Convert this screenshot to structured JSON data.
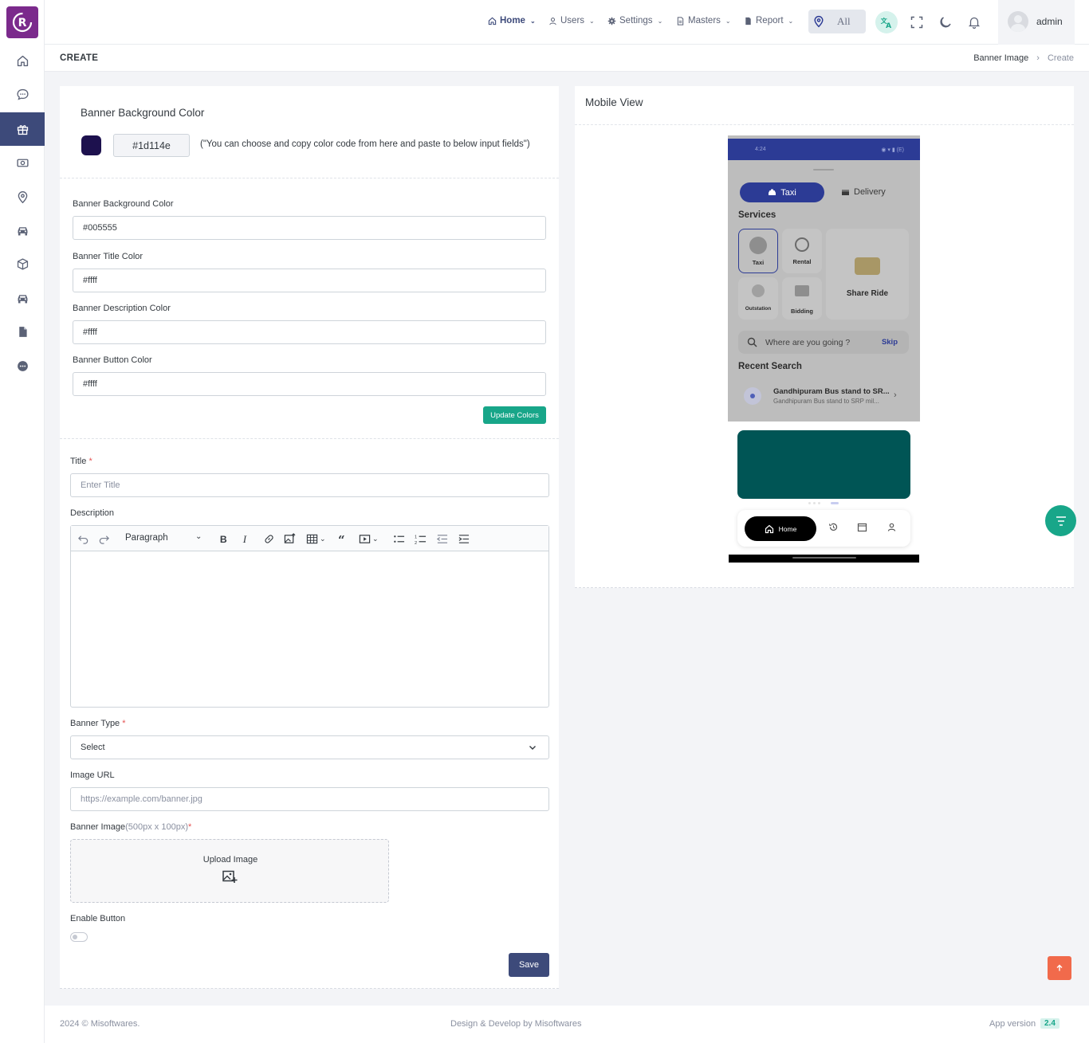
{
  "topbar": {
    "menu": [
      {
        "label": "Home",
        "icon": "home-icon"
      },
      {
        "label": "Users",
        "icon": "user-icon"
      },
      {
        "label": "Settings",
        "icon": "gear-icon"
      },
      {
        "label": "Masters",
        "icon": "document-icon"
      },
      {
        "label": "Report",
        "icon": "file-icon"
      }
    ],
    "zone_label": "All",
    "user_name": "admin"
  },
  "page": {
    "title": "CREATE",
    "breadcrumb": [
      "Banner Image",
      "Create"
    ]
  },
  "color_picker": {
    "heading": "Banner Background Color",
    "swatch_color": "#1d114e",
    "code": "#1d114e",
    "hint": "(\"You can choose and copy color code from here and paste to below input fields\")"
  },
  "color_form": {
    "bg_label": "Banner Background Color",
    "bg_value": "#005555",
    "title_label": "Banner Title Color",
    "title_value": "#ffff",
    "desc_label": "Banner Description Color",
    "desc_value": "#ffff",
    "button_label": "Banner Button Color",
    "button_value": "#ffff",
    "update_button": "Update Colors"
  },
  "form": {
    "title_label": "Title",
    "title_placeholder": "Enter Title",
    "description_label": "Description",
    "paragraph_select": "Paragraph",
    "banner_type_label": "Banner Type",
    "banner_type_value": "Select",
    "image_url_label": "Image URL",
    "image_url_placeholder": "https://example.com/banner.jpg",
    "banner_image_label": "Banner Image",
    "banner_image_size": "(500px x 100px)",
    "upload_label": "Upload Image",
    "enable_button_label": "Enable Button",
    "required_mark": "*",
    "save_button": "Save"
  },
  "mobile": {
    "heading": "Mobile View",
    "status_time": "4:24",
    "status_right": "◉ ▾ ▮ (E)",
    "tab_taxi": "Taxi",
    "tab_delivery": "Delivery",
    "services_title": "Services",
    "services": [
      "Taxi",
      "Rental",
      "Share Ride",
      "Outstation",
      "Bidding"
    ],
    "search_placeholder": "Where are you going ?",
    "skip": "Skip",
    "recent_title": "Recent Search",
    "recent_item_title": "Gandhipuram Bus stand to SR...",
    "recent_item_sub": "Gandhipuram Bus stand to SRP mil...",
    "banner_color": "#005555",
    "nav_home": "Home"
  },
  "footer": {
    "copyright": "2024 © Misoftwares.",
    "credit": "Design & Develop by Misoftwares",
    "version_label": "App version",
    "version": "2.4"
  },
  "colors": {
    "primary": "#3d4a7a",
    "teal": "#18a689",
    "logo": "#7b2a8c",
    "orange": "#f16a4b"
  }
}
